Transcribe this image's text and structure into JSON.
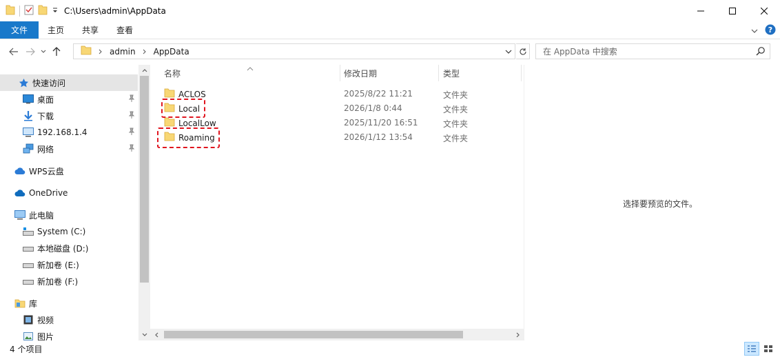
{
  "window": {
    "title": "C:\\Users\\admin\\AppData"
  },
  "ribbon": {
    "tabs": [
      {
        "label": "文件"
      },
      {
        "label": "主页"
      },
      {
        "label": "共享"
      },
      {
        "label": "查看"
      }
    ]
  },
  "address": {
    "crumbs": [
      "admin",
      "AppData"
    ]
  },
  "search": {
    "placeholder": "在 AppData 中搜索"
  },
  "nav": {
    "items": [
      {
        "label": "快速访问",
        "icon": "star-icon"
      },
      {
        "label": "桌面",
        "icon": "desktop-icon"
      },
      {
        "label": "下载",
        "icon": "download-icon"
      },
      {
        "label": "192.168.1.4",
        "icon": "monitor-icon"
      },
      {
        "label": "网络",
        "icon": "network-icon"
      },
      {
        "label": "WPS云盘",
        "icon": "wps-cloud-icon"
      },
      {
        "label": "OneDrive",
        "icon": "onedrive-icon"
      },
      {
        "label": "此电脑",
        "icon": "this-pc-icon"
      },
      {
        "label": "System (C:)",
        "icon": "system-drive-icon"
      },
      {
        "label": "本地磁盘 (D:)",
        "icon": "drive-icon"
      },
      {
        "label": "新加卷 (E:)",
        "icon": "drive-icon"
      },
      {
        "label": "新加卷 (F:)",
        "icon": "drive-icon"
      },
      {
        "label": "库",
        "icon": "library-icon"
      },
      {
        "label": "视频",
        "icon": "video-icon"
      },
      {
        "label": "图片",
        "icon": "picture-icon"
      }
    ]
  },
  "filelist": {
    "headers": {
      "name": "名称",
      "date": "修改日期",
      "type": "类型"
    },
    "rows": [
      {
        "name": "ACLOS",
        "date": "2025/8/22 11:21",
        "type": "文件夹"
      },
      {
        "name": "Local",
        "date": "2026/1/8 0:44",
        "type": "文件夹"
      },
      {
        "name": "LocalLow",
        "date": "2025/11/20 16:51",
        "type": "文件夹"
      },
      {
        "name": "Roaming",
        "date": "2026/1/12 13:54",
        "type": "文件夹"
      }
    ]
  },
  "preview": {
    "empty_text": "选择要预览的文件。"
  },
  "status": {
    "item_count": "4 个项目"
  },
  "colors": {
    "accent": "#1979ca",
    "folder": "#f8d775",
    "highlight": "#e0141e"
  }
}
